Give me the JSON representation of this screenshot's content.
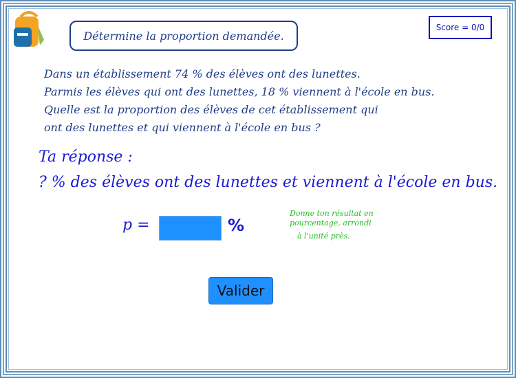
{
  "instruction": "Détermine la proportion demandée.",
  "score": "Score = 0/0",
  "problem": {
    "lines": [
      "Dans un établissement 74 % des élèves ont des lunettes.",
      "Parmis les élèves qui ont des lunettes, 18 % viennent à l'école en bus.",
      "Quelle est la proportion des élèves de cet établissement qui",
      "ont des lunettes et qui viennent à l'école en bus ?"
    ]
  },
  "answer": {
    "title": "Ta réponse :",
    "sentence": "? % des élèves ont des lunettes et viennent à l'école en bus.",
    "variable_label": "p =",
    "input_value": "",
    "unit": "%"
  },
  "hint": {
    "lines": [
      "Donne ton résultat en",
      "pourcentage, arrondi",
      "à l'unité près."
    ]
  },
  "validate_label": "Valider",
  "colors": {
    "accent_blue": "#1e90ff",
    "text_blue": "#1a1ad6",
    "dark_blue": "#1f3d8a",
    "hint_green": "#22bb22"
  }
}
